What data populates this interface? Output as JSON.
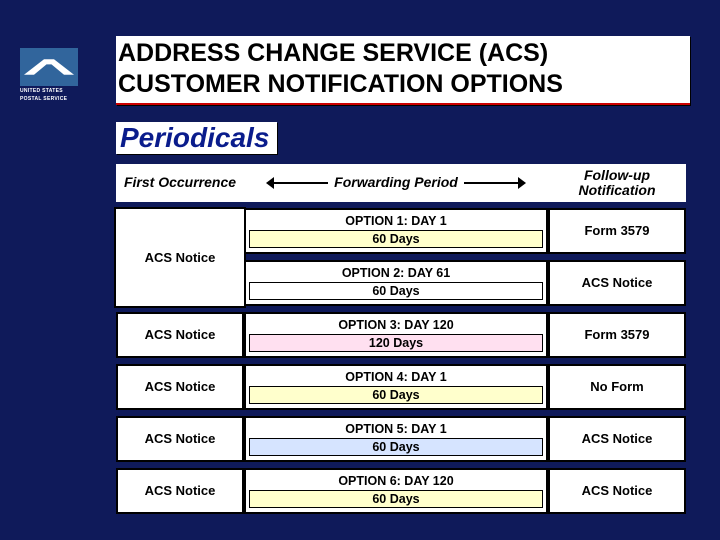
{
  "title_line": "ADDRESS CHANGE SERVICE (ACS) CUSTOMER NOTIFICATION OPTIONS",
  "subtitle": "Periodicals",
  "logo_text_1": "UNITED STATES",
  "logo_text_2": "POSTAL SERVICE",
  "headers": {
    "first": "First Occurrence",
    "mid": "Forwarding Period",
    "last": "Follow-up Notification"
  },
  "rows": [
    {
      "first": "ACS Notice",
      "opt": "OPTION 1:  DAY 1",
      "days": "60 Days",
      "days_bg": "bg-yellow",
      "last": "Form 3579"
    },
    {
      "first": "",
      "opt": "OPTION 2:  DAY 61",
      "days": "60 Days",
      "days_bg": "bg-white",
      "last": "ACS Notice",
      "merge_first_with_prev": true
    },
    {
      "first": "ACS Notice",
      "opt": "OPTION 3:  DAY 120",
      "days": "120 Days",
      "days_bg": "bg-pink",
      "last": "Form 3579"
    },
    {
      "first": "ACS Notice",
      "opt": "OPTION 4:  DAY 1",
      "days": "60 Days",
      "days_bg": "bg-yellow",
      "last": "No Form"
    },
    {
      "first": "ACS Notice",
      "opt": "OPTION 5:  DAY 1",
      "days": "60 Days",
      "days_bg": "bg-blue",
      "last": "ACS Notice"
    },
    {
      "first": "ACS Notice",
      "opt": "OPTION 6:  DAY 120",
      "days": "60 Days",
      "days_bg": "bg-yellow",
      "last": "ACS Notice"
    }
  ]
}
